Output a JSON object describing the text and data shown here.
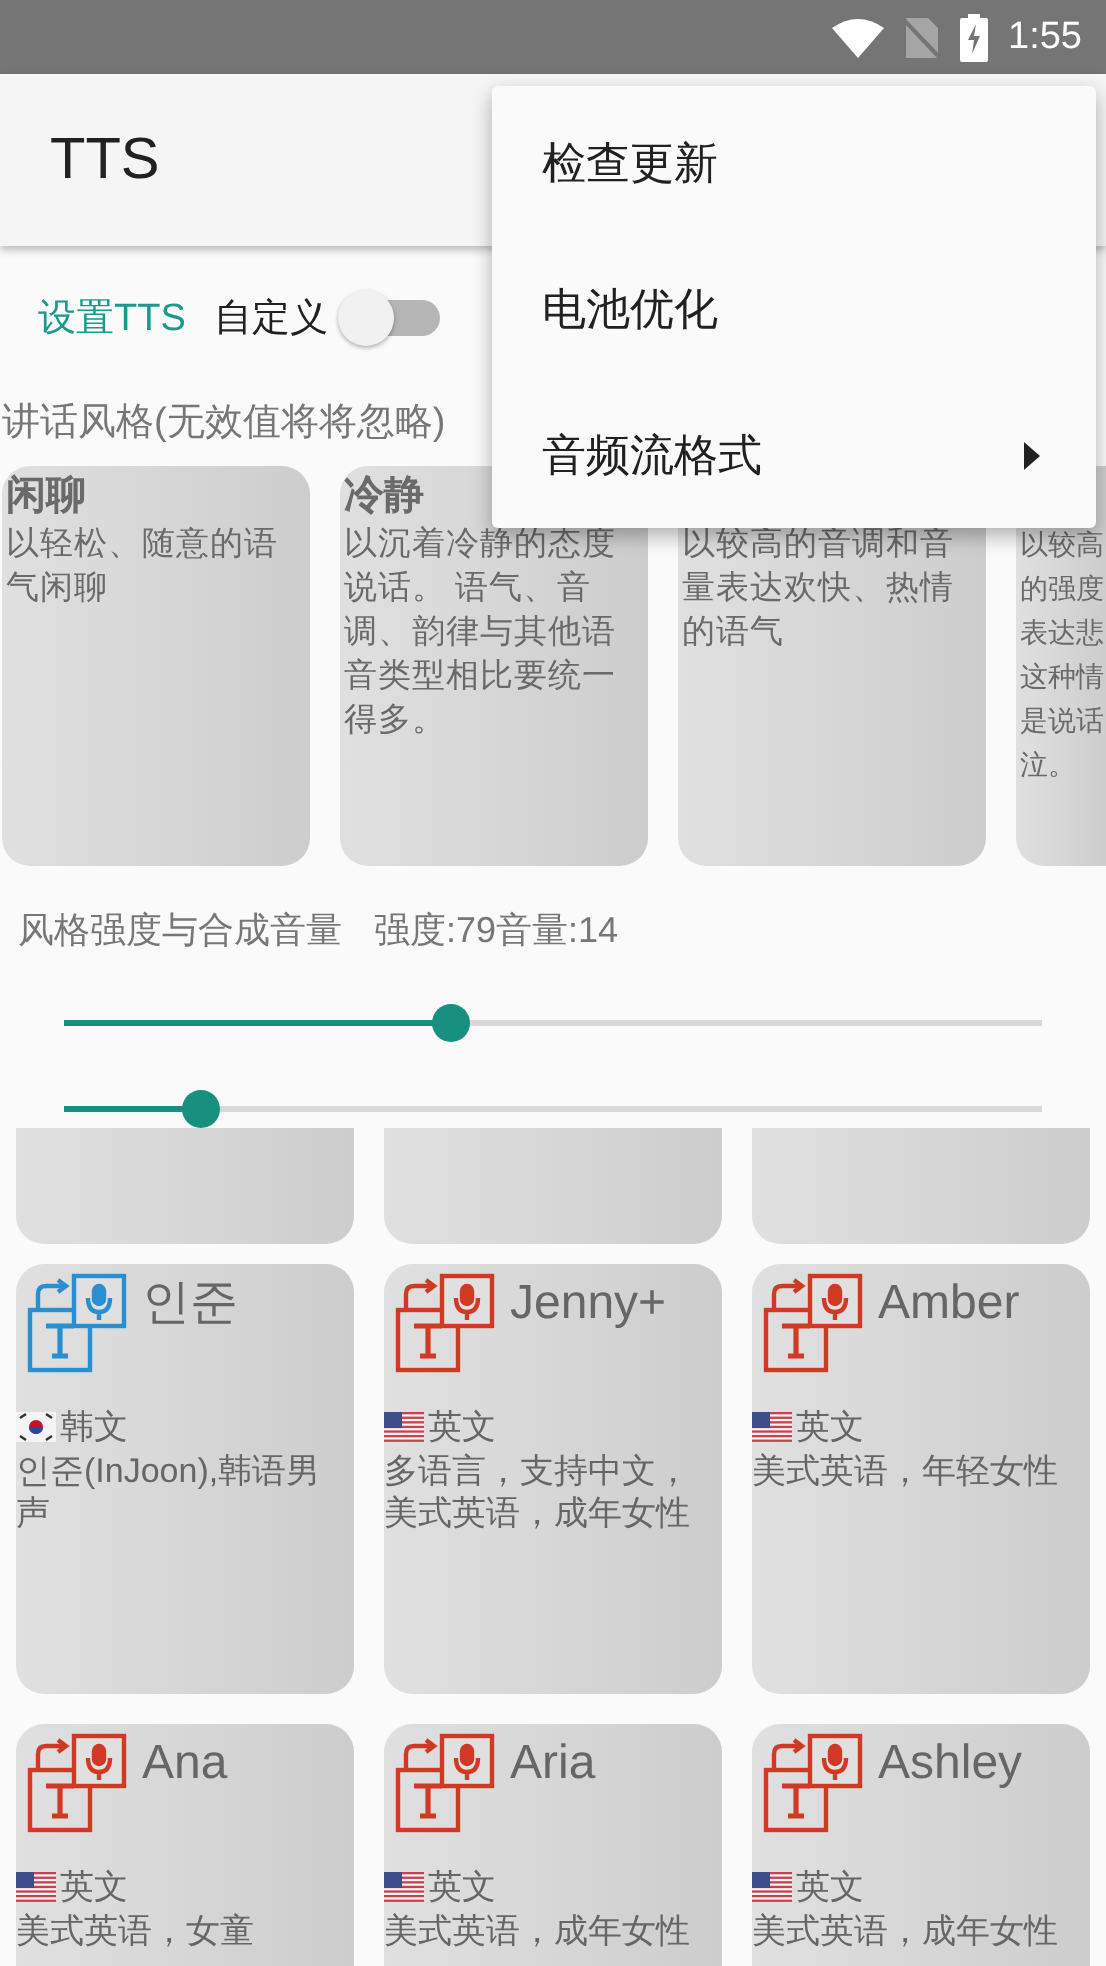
{
  "status_bar": {
    "time": "1:55"
  },
  "app_bar": {
    "title": "TTS"
  },
  "menu": {
    "items": [
      {
        "label": "检查更新",
        "submenu": false
      },
      {
        "label": "电池优化",
        "submenu": false
      },
      {
        "label": "音频流格式",
        "submenu": true
      }
    ]
  },
  "settings_row": {
    "link": "设置TTS",
    "switch_label": "自定义",
    "switch_on": false
  },
  "styles_heading": "讲话风格(无效值将将忽略)",
  "styles": [
    {
      "title": "闲聊",
      "description": "以轻松、随意的语气闲聊"
    },
    {
      "title": "冷静",
      "description": "以沉着冷静的态度说话。 语气、音调、韵律与其他语音类型相比要统一得多。"
    },
    {
      "description": "以较高的音调和音量表达欢快、热情的语气"
    },
    {
      "description_lines": [
        "以较高",
        "的强度",
        "表达悲",
        "这种情",
        "是说话",
        "泣。"
      ]
    }
  ],
  "strength": {
    "label": "风格强度与合成音量",
    "reading": "强度:79音量:14",
    "sliders": [
      {
        "level": 0.395
      },
      {
        "level": 0.139
      }
    ]
  },
  "voices": [
    {
      "kind": "partial"
    },
    {
      "kind": "partial"
    },
    {
      "kind": "partial"
    },
    {
      "kind": "korean",
      "name": "인준",
      "color": "#2a8fd0",
      "language": "韩文",
      "description": "인준(InJoon),韩语男声"
    },
    {
      "kind": "american",
      "name": "Jenny+",
      "color": "#d03a24",
      "language": "英文",
      "description": "多语言，支持中文，美式英语，成年女性"
    },
    {
      "kind": "american",
      "name": "Amber",
      "color": "#d03a24",
      "language": "英文",
      "description": "美式英语，年轻女性"
    },
    {
      "kind": "american",
      "name": "Ana",
      "color": "#d03a24",
      "language": "英文",
      "description": "美式英语，女童"
    },
    {
      "kind": "american",
      "name": "Aria",
      "color": "#d03a24",
      "language": "英文",
      "description": "美式英语，成年女性"
    },
    {
      "kind": "american",
      "name": "Ashley",
      "color": "#d03a24",
      "language": "英文",
      "description": "美式英语，成年女性"
    }
  ]
}
